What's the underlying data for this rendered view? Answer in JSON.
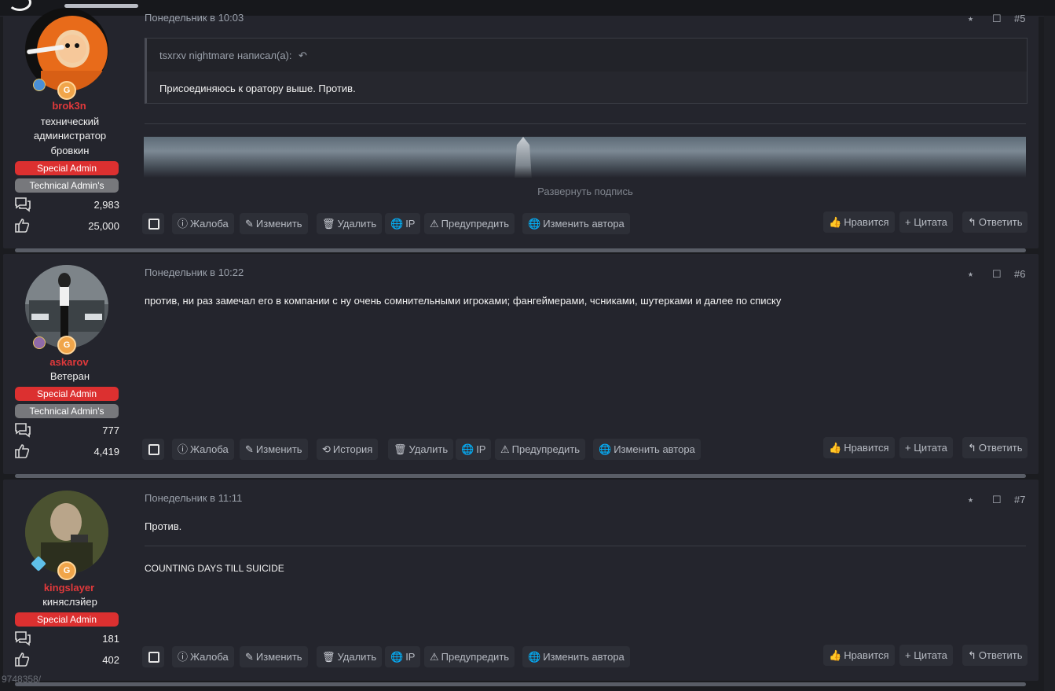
{
  "posts": [
    {
      "number": "#5",
      "date": "Понедельник в 10:03",
      "user": {
        "name": "brok3n",
        "title_lines": [
          "технический",
          "администратор",
          "бровкин"
        ],
        "roles": [
          "Special Admin",
          "Technical Admin's"
        ],
        "messages": "2,983",
        "likes": "25,000"
      },
      "quote": {
        "author": "tsxrxv nightmare написал(а):",
        "text": "Присоединяюсь к оратору выше. Против."
      },
      "signature_toggle": "Развернуть подпись",
      "actions": [
        "Жалоба",
        "Изменить",
        "Удалить",
        "IP",
        "Предупредить",
        "Изменить автора"
      ],
      "right_actions": [
        "Нравится",
        "+ Цитата",
        "Ответить"
      ]
    },
    {
      "number": "#6",
      "date": "Понедельник в 10:22",
      "user": {
        "name": "askarov",
        "title_lines": [
          "Ветеран"
        ],
        "roles": [
          "Special Admin",
          "Technical Admin's"
        ],
        "messages": "777",
        "likes": "4,419"
      },
      "text": "против, ни раз замечал его в компании с ну очень сомнительными игроками; фангеймерами, чсниками, шутерками и далее по списку",
      "actions": [
        "Жалоба",
        "Изменить",
        "История",
        "Удалить",
        "IP",
        "Предупредить",
        "Изменить автора"
      ],
      "right_actions": [
        "Нравится",
        "+ Цитата",
        "Ответить"
      ]
    },
    {
      "number": "#7",
      "date": "Понедельник в 11:11",
      "user": {
        "name": "kingslayer",
        "title_lines": [
          "киняслэйер"
        ],
        "roles": [
          "Special Admin"
        ],
        "messages": "181",
        "likes": "402"
      },
      "text": "Против.",
      "signature": "COUNTING DAYS TILL SUICIDE",
      "actions": [
        "Жалоба",
        "Изменить",
        "Удалить",
        "IP",
        "Предупредить",
        "Изменить автора"
      ],
      "right_actions": [
        "Нравится",
        "+ Цитата",
        "Ответить"
      ]
    }
  ],
  "avatar_badge": "G",
  "footer_fragment": "9748358/",
  "icons": {
    "share": "share-icon",
    "bookmark": "bookmark-icon",
    "messages": "messages-icon",
    "like": "thumbs-up-icon",
    "report": "alert-circle-icon",
    "edit": "pencil-icon",
    "delete": "trash-icon",
    "ip": "globe-icon",
    "warn": "warning-triangle-icon",
    "history": "history-icon",
    "reply": "reply-icon",
    "quote_back": "reply-arrow-icon"
  },
  "colors": {
    "background": "#1b1c20",
    "post_bg": "#24252d",
    "username": "#e0393b",
    "role_red": "#dc3030",
    "role_gray": "#77787c",
    "badge_orange": "#f0a54a"
  }
}
